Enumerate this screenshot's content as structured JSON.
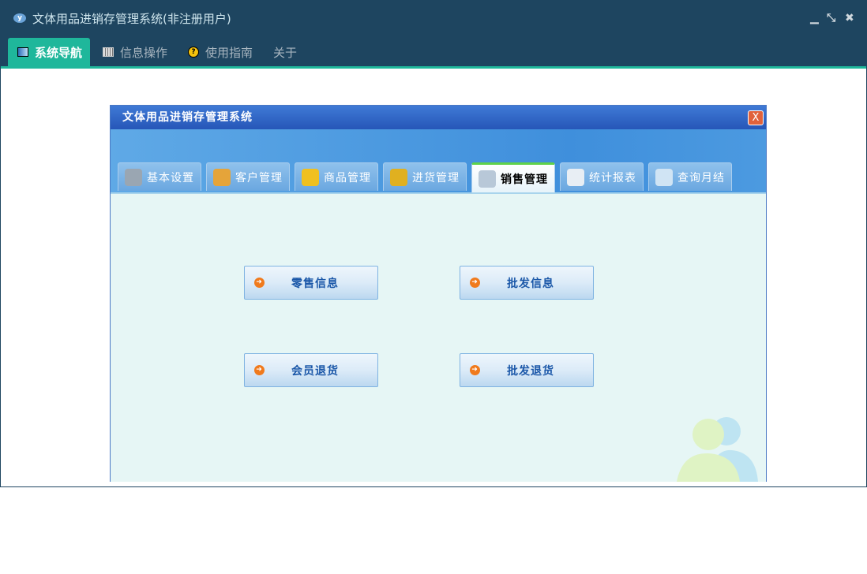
{
  "window": {
    "title": "文体用品进销存管理系统(非注册用户)",
    "controls": {
      "minimize": "▁",
      "restore": "⤡",
      "close": "✖"
    }
  },
  "menu": [
    {
      "label": "系统导航",
      "icon": "monitor-icon",
      "active": true
    },
    {
      "label": "信息操作",
      "icon": "grid-icon"
    },
    {
      "label": "使用指南",
      "icon": "help-icon"
    },
    {
      "label": "关于"
    }
  ],
  "inner": {
    "title": "文体用品进销存管理系统",
    "close": "X",
    "tabs": [
      {
        "label": "基本设置",
        "icon": "gear-icon",
        "color": "#9aa6b2"
      },
      {
        "label": "客户管理",
        "icon": "users-icon",
        "color": "#e5a43a"
      },
      {
        "label": "商品管理",
        "icon": "star-icon",
        "color": "#f0c020"
      },
      {
        "label": "进货管理",
        "icon": "house-icon",
        "color": "#e0b020"
      },
      {
        "label": "销售管理",
        "icon": "computer-icon",
        "color": "#b8c8d8",
        "active": true
      },
      {
        "label": "统计报表",
        "icon": "book-icon",
        "color": "#e8eef4"
      },
      {
        "label": "查询月结",
        "icon": "magnifier-icon",
        "color": "#d0e4f4"
      }
    ],
    "buttons": [
      "零售信息",
      "批发信息",
      "会员退货",
      "批发退货"
    ]
  }
}
